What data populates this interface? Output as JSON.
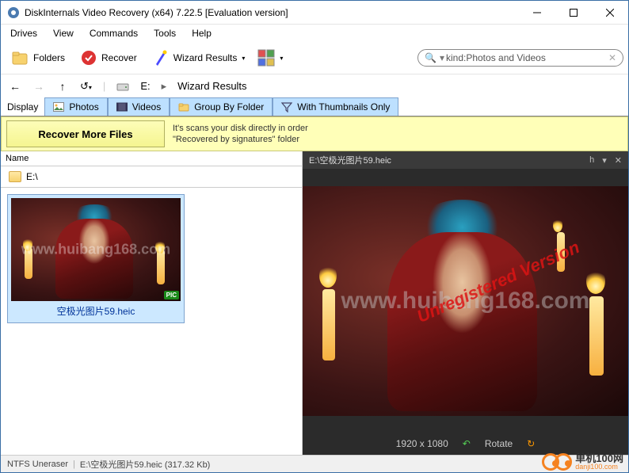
{
  "window": {
    "title": "DiskInternals Video Recovery (x64) 7.22.5 [Evaluation version]"
  },
  "menu": {
    "drives": "Drives",
    "view": "View",
    "commands": "Commands",
    "tools": "Tools",
    "help": "Help"
  },
  "toolbar": {
    "folders": "Folders",
    "recover": "Recover",
    "wizard_results": "Wizard Results"
  },
  "search": {
    "value": "kind:Photos and Videos"
  },
  "nav": {
    "drive": "E:",
    "crumb": "Wizard Results"
  },
  "tabs": {
    "display_label": "Display",
    "photos": "Photos",
    "videos": "Videos",
    "group_by_folder": "Group By Folder",
    "with_thumbs": "With Thumbnails Only"
  },
  "info": {
    "button": "Recover More Files",
    "text1": "It's scans your disk directly in order",
    "text2": "\"Recovered by signatures\" folder"
  },
  "tree": {
    "header": "Name",
    "root": "E:\\"
  },
  "thumb": {
    "filename": "空极光图片59.heic",
    "badge": "PIC",
    "watermark": "www.huibang168.com"
  },
  "preview": {
    "title": "E:\\空极光图片59.heic",
    "control_h": "h",
    "dimensions": "1920 x 1080",
    "rotate": "Rotate",
    "watermark": "www.huibang168.com",
    "unregistered": "Unregistered Version"
  },
  "status": {
    "app": "NTFS Uneraser",
    "path": "E:\\空极光图片59.heic (317.32 Kb)"
  },
  "overlay": {
    "cn": "单机100网",
    "en": "danji100.com"
  }
}
